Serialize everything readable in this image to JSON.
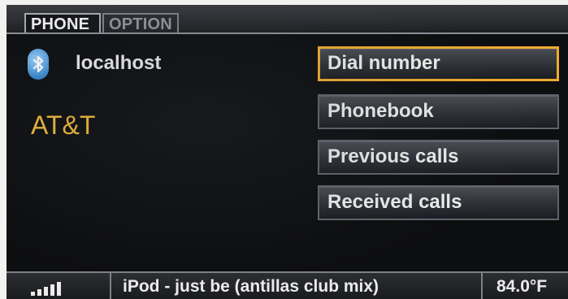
{
  "tabs": [
    {
      "label": "PHONE",
      "active": true
    },
    {
      "label": "OPTION",
      "active": false
    }
  ],
  "device": {
    "icon": "bluetooth-icon",
    "name": "localhost"
  },
  "carrier": "AT&T",
  "menu": [
    {
      "label": "Dial number",
      "selected": true
    },
    {
      "label": "Phonebook",
      "selected": false
    },
    {
      "label": "Previous calls",
      "selected": false
    },
    {
      "label": "Received calls",
      "selected": false
    }
  ],
  "status": {
    "signal_icon": "signal-strength-icon",
    "signal_bars": 5,
    "media": "iPod - just be (antillas club mix)",
    "temperature": "84.0°F"
  },
  "colors": {
    "accent": "#f0a92e",
    "carrier": "#f0b838",
    "background": "#0d0e10"
  }
}
